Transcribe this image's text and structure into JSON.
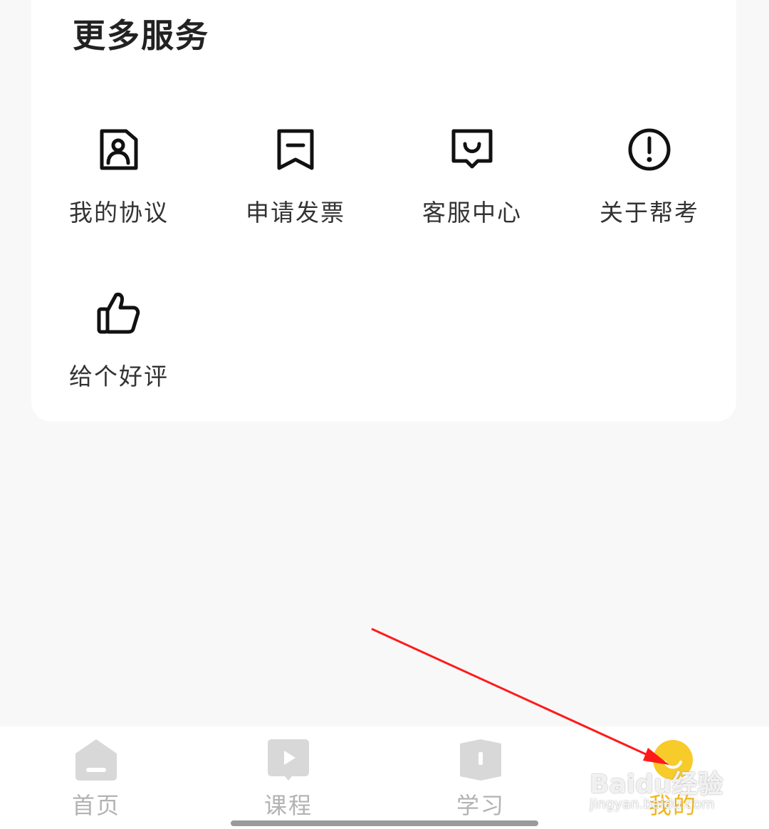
{
  "section": {
    "title": "更多服务"
  },
  "services": [
    {
      "label": "我的协议",
      "icon": "contract-icon"
    },
    {
      "label": "申请发票",
      "icon": "invoice-icon"
    },
    {
      "label": "客服中心",
      "icon": "customer-service-icon"
    },
    {
      "label": "关于帮考",
      "icon": "info-icon"
    },
    {
      "label": "给个好评",
      "icon": "thumbs-up-icon"
    }
  ],
  "tabbar": {
    "active_index": 3,
    "items": [
      {
        "label": "首页",
        "icon": "home-icon"
      },
      {
        "label": "课程",
        "icon": "play-icon"
      },
      {
        "label": "学习",
        "icon": "book-icon"
      },
      {
        "label": "我的",
        "icon": "smiley-icon"
      }
    ]
  },
  "watermark": {
    "brand": "Baidu经验",
    "url": "jingyan.baidu.com"
  },
  "colors": {
    "accent": "#f0b51e",
    "inactive": "#b3b3b3",
    "annotation": "#ff1a1a",
    "background": "#f8f8f8"
  }
}
